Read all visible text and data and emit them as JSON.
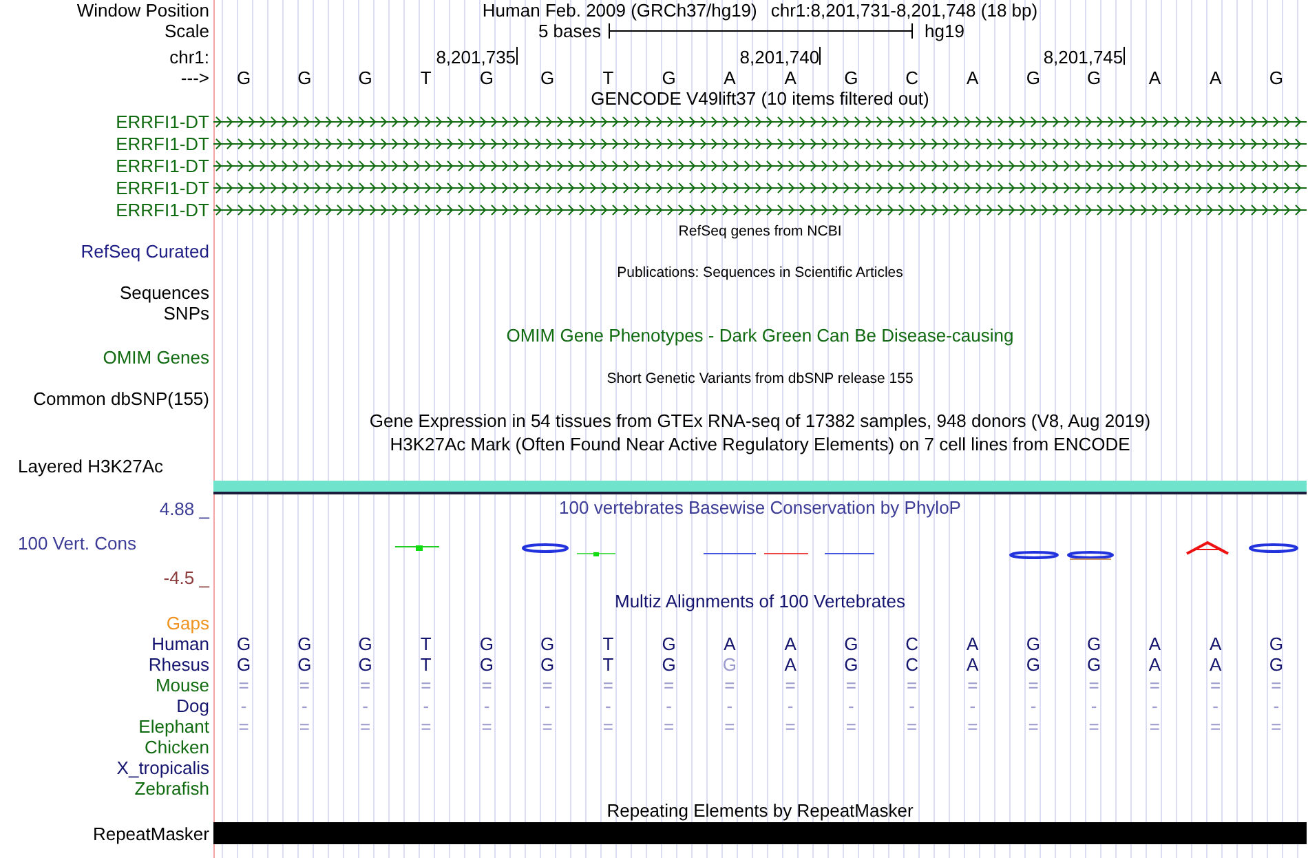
{
  "position": {
    "label": "Window Position",
    "assembly": "Human Feb. 2009 (GRCh37/hg19)",
    "range": "chr1:8,201,731-8,201,748 (18 bp)"
  },
  "scale": {
    "label": "Scale",
    "bar_label": "5 bases",
    "assembly": "hg19"
  },
  "ruler": {
    "label": "chr1:",
    "ticks": [
      "8,201,735",
      "8,201,740",
      "8,201,745"
    ]
  },
  "sequence": {
    "label": "--->",
    "bases": [
      "G",
      "G",
      "G",
      "T",
      "G",
      "G",
      "T",
      "G",
      "A",
      "A",
      "G",
      "C",
      "A",
      "G",
      "G",
      "A",
      "A",
      "G"
    ]
  },
  "tracks": [
    {
      "kind": "genes",
      "title": "GENCODE V49lift37 (10 items filtered out)",
      "color": "#000000",
      "transcripts": [
        {
          "label": "ERRFI1-DT",
          "color": "#106b10"
        },
        {
          "label": "ERRFI1-DT",
          "color": "#106b10"
        },
        {
          "label": "ERRFI1-DT",
          "color": "#106b10"
        },
        {
          "label": "ERRFI1-DT",
          "color": "#106b10"
        },
        {
          "label": "ERRFI1-DT",
          "color": "#106b10"
        }
      ]
    },
    {
      "kind": "note",
      "text": "RefSeq genes from NCBI"
    },
    {
      "kind": "label",
      "label": "RefSeq Curated",
      "color": "#1c1c84"
    },
    {
      "kind": "note",
      "text": "Publications: Sequences in Scientific Articles"
    },
    {
      "kind": "label",
      "label": "Sequences",
      "color": "#000000"
    },
    {
      "kind": "label",
      "label": "SNPs",
      "color": "#000000"
    },
    {
      "kind": "title",
      "text": "OMIM Gene Phenotypes - Dark Green Can Be Disease-causing",
      "color": "#106b10"
    },
    {
      "kind": "label",
      "label": "OMIM Genes",
      "color": "#106b10"
    },
    {
      "kind": "note",
      "text": "Short Genetic Variants from dbSNP release 155"
    },
    {
      "kind": "label",
      "label": "Common dbSNP(155)",
      "color": "#000000"
    },
    {
      "kind": "title",
      "text": "Gene Expression in 54 tissues from GTEx RNA-seq of 17382 samples, 948 donors (V8, Aug 2019)",
      "color": "#000000"
    },
    {
      "kind": "title",
      "text": "H3K27Ac Mark (Often Found Near Active Regulatory Elements) on 7 cell lines from ENCODE",
      "color": "#000000"
    },
    {
      "kind": "layered",
      "label": "Layered H3K27Ac",
      "color": "#000000"
    },
    {
      "kind": "conservation",
      "title": "100 vertebrates Basewise Conservation by PhyloP",
      "label": "100 Vert. Cons",
      "max": "4.88 _",
      "min": "-4.5 _"
    },
    {
      "kind": "title",
      "text": "Multiz Alignments of 100 Vertebrates",
      "color": "#14146e"
    },
    {
      "kind": "label",
      "label": "Gaps",
      "color": "#f0921e"
    },
    {
      "kind": "species",
      "label": "Human",
      "color": "#14146e",
      "bases": [
        {
          "text": "G",
          "faded": false
        },
        {
          "text": "G",
          "faded": false
        },
        {
          "text": "G",
          "faded": false
        },
        {
          "text": "T",
          "faded": false
        },
        {
          "text": "G",
          "faded": false
        },
        {
          "text": "G",
          "faded": false
        },
        {
          "text": "T",
          "faded": false
        },
        {
          "text": "G",
          "faded": false
        },
        {
          "text": "A",
          "faded": false
        },
        {
          "text": "A",
          "faded": false
        },
        {
          "text": "G",
          "faded": false
        },
        {
          "text": "C",
          "faded": false
        },
        {
          "text": "A",
          "faded": false
        },
        {
          "text": "G",
          "faded": false
        },
        {
          "text": "G",
          "faded": false
        },
        {
          "text": "A",
          "faded": false
        },
        {
          "text": "A",
          "faded": false
        },
        {
          "text": "G",
          "faded": false
        }
      ]
    },
    {
      "kind": "species",
      "label": "Rhesus",
      "color": "#14146e",
      "bases": [
        {
          "text": "G",
          "faded": false
        },
        {
          "text": "G",
          "faded": false
        },
        {
          "text": "G",
          "faded": false
        },
        {
          "text": "T",
          "faded": false
        },
        {
          "text": "G",
          "faded": false
        },
        {
          "text": "G",
          "faded": false
        },
        {
          "text": "T",
          "faded": false
        },
        {
          "text": "G",
          "faded": false
        },
        {
          "text": "G",
          "faded": true
        },
        {
          "text": "A",
          "faded": false
        },
        {
          "text": "G",
          "faded": false
        },
        {
          "text": "C",
          "faded": false
        },
        {
          "text": "A",
          "faded": false
        },
        {
          "text": "G",
          "faded": false
        },
        {
          "text": "G",
          "faded": false
        },
        {
          "text": "A",
          "faded": false
        },
        {
          "text": "A",
          "faded": false
        },
        {
          "text": "G",
          "faded": false
        }
      ]
    },
    {
      "kind": "species",
      "label": "Mouse",
      "color": "#106b10",
      "bases": [
        {
          "text": "=",
          "faded": true
        },
        {
          "text": "=",
          "faded": true
        },
        {
          "text": "=",
          "faded": true
        },
        {
          "text": "=",
          "faded": true
        },
        {
          "text": "=",
          "faded": true
        },
        {
          "text": "=",
          "faded": true
        },
        {
          "text": "=",
          "faded": true
        },
        {
          "text": "=",
          "faded": true
        },
        {
          "text": "=",
          "faded": true
        },
        {
          "text": "=",
          "faded": true
        },
        {
          "text": "=",
          "faded": true
        },
        {
          "text": "=",
          "faded": true
        },
        {
          "text": "=",
          "faded": true
        },
        {
          "text": "=",
          "faded": true
        },
        {
          "text": "=",
          "faded": true
        },
        {
          "text": "=",
          "faded": true
        },
        {
          "text": "=",
          "faded": true
        },
        {
          "text": "=",
          "faded": true
        }
      ]
    },
    {
      "kind": "species",
      "label": "Dog",
      "color": "#14146e",
      "bases": [
        {
          "text": "-",
          "faded": true
        },
        {
          "text": "-",
          "faded": true
        },
        {
          "text": "-",
          "faded": true
        },
        {
          "text": "-",
          "faded": true
        },
        {
          "text": "-",
          "faded": true
        },
        {
          "text": "-",
          "faded": true
        },
        {
          "text": "-",
          "faded": true
        },
        {
          "text": "-",
          "faded": true
        },
        {
          "text": "-",
          "faded": true
        },
        {
          "text": "-",
          "faded": true
        },
        {
          "text": "-",
          "faded": true
        },
        {
          "text": "-",
          "faded": true
        },
        {
          "text": "-",
          "faded": true
        },
        {
          "text": "-",
          "faded": true
        },
        {
          "text": "-",
          "faded": true
        },
        {
          "text": "-",
          "faded": true
        },
        {
          "text": "-",
          "faded": true
        },
        {
          "text": "-",
          "faded": true
        }
      ]
    },
    {
      "kind": "species",
      "label": "Elephant",
      "color": "#106b10",
      "bases": [
        {
          "text": "=",
          "faded": true
        },
        {
          "text": "=",
          "faded": true
        },
        {
          "text": "=",
          "faded": true
        },
        {
          "text": "=",
          "faded": true
        },
        {
          "text": "=",
          "faded": true
        },
        {
          "text": "=",
          "faded": true
        },
        {
          "text": "=",
          "faded": true
        },
        {
          "text": "=",
          "faded": true
        },
        {
          "text": "=",
          "faded": true
        },
        {
          "text": "=",
          "faded": true
        },
        {
          "text": "=",
          "faded": true
        },
        {
          "text": "=",
          "faded": true
        },
        {
          "text": "=",
          "faded": true
        },
        {
          "text": "=",
          "faded": true
        },
        {
          "text": "=",
          "faded": true
        },
        {
          "text": "=",
          "faded": true
        },
        {
          "text": "=",
          "faded": true
        },
        {
          "text": "=",
          "faded": true
        }
      ]
    },
    {
      "kind": "species",
      "label": "Chicken",
      "color": "#106b10"
    },
    {
      "kind": "species",
      "label": "X_tropicalis",
      "color": "#14146e"
    },
    {
      "kind": "species",
      "label": "Zebrafish",
      "color": "#106b10"
    },
    {
      "kind": "title",
      "text": "Repeating Elements by RepeatMasker",
      "color": "#000000"
    },
    {
      "kind": "repeat",
      "label": "RepeatMasker",
      "color": "#000000"
    }
  ]
}
